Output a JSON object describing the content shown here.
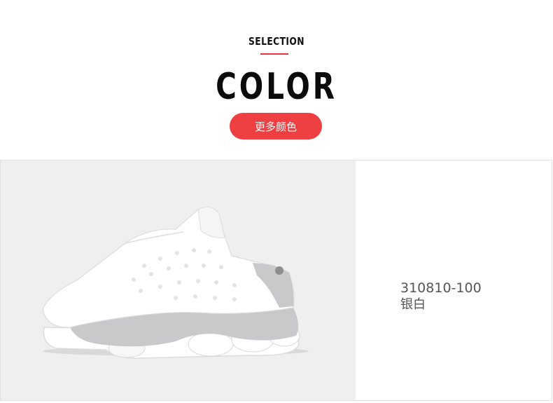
{
  "header": {
    "eyebrow": "SELECTION",
    "title": "COLOR",
    "more_colors_button": "更多颜色"
  },
  "product": {
    "sku": "310810-100",
    "color_name": "银白",
    "image": "white-gray-low-top-sneaker"
  },
  "colors": {
    "accent": "#ee3f42",
    "title": "#0b0b0b",
    "photo_bg": "#efefef",
    "shoe_white": "#ffffff",
    "shoe_gray": "#c9c9cb"
  }
}
